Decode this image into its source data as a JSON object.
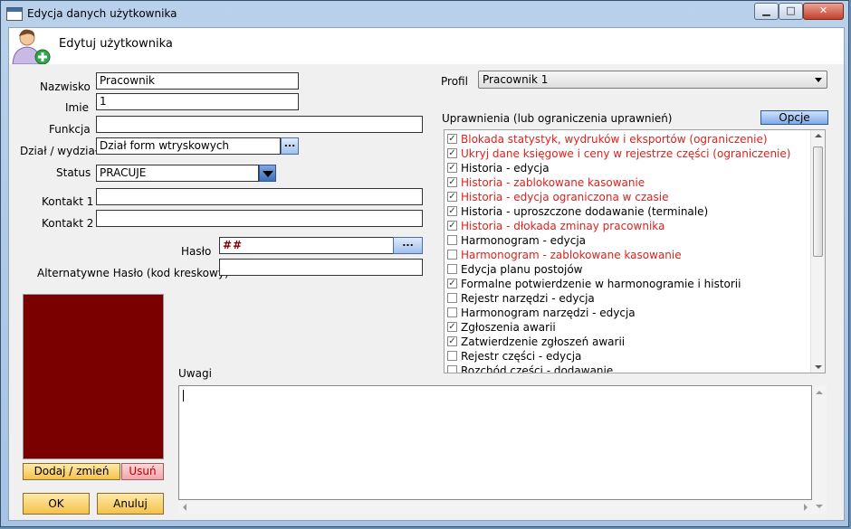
{
  "window": {
    "title": "Edycja danych użytkownika",
    "minimize": "▁",
    "maximize": "□",
    "close": "✕"
  },
  "header": {
    "title": "Edytuj użytkownika"
  },
  "form": {
    "nazwisko_label": "Nazwisko",
    "nazwisko_value": "Pracownik",
    "imie_label": "Imie",
    "imie_value": "1",
    "funkcja_label": "Funkcja",
    "funkcja_value": "",
    "dzial_label": "Dział / wydział",
    "dzial_value": "Dział form wtryskowych",
    "dzial_button": "...",
    "status_label": "Status",
    "status_value": "PRACUJE",
    "kontakt1_label": "Kontakt 1",
    "kontakt1_value": "",
    "kontakt2_label": "Kontakt 2",
    "kontakt2_value": "",
    "haslo_label": "Hasło",
    "haslo_value": "##",
    "haslo_button": "...",
    "alt_haslo_label": "Alternatywne Hasło (kod kreskowy)",
    "alt_haslo_value": "",
    "uwagi_label": "Uwagi",
    "uwagi_value": ""
  },
  "profile": {
    "label": "Profil",
    "value": "Pracownik 1"
  },
  "permissions": {
    "label": "Uprawnienia (lub ograniczenia uprawnień)",
    "options_button": "Opcje",
    "items": [
      {
        "label": "Blokada statystyk, wydruków i eksportów (ograniczenie)",
        "checked": true,
        "restriction": true
      },
      {
        "label": "Ukryj dane księgowe i ceny w rejestrze części (ograniczenie)",
        "checked": true,
        "restriction": true
      },
      {
        "label": "Historia - edycja",
        "checked": true,
        "restriction": false
      },
      {
        "label": "Historia - zablokowane kasowanie",
        "checked": true,
        "restriction": true
      },
      {
        "label": "Historia - edycja ograniczona w czasie",
        "checked": true,
        "restriction": true
      },
      {
        "label": "Historia - uproszczone dodawanie (terminale)",
        "checked": true,
        "restriction": false
      },
      {
        "label": "Historia - dłokada zminay pracownika",
        "checked": true,
        "restriction": true
      },
      {
        "label": "Harmonogram - edycja",
        "checked": false,
        "restriction": false
      },
      {
        "label": "Harmonogram - zablokowane kasowanie",
        "checked": false,
        "restriction": true
      },
      {
        "label": "Edycja planu postojów",
        "checked": false,
        "restriction": false
      },
      {
        "label": "Formalne potwierdzenie w harmonogramie i historii",
        "checked": true,
        "restriction": false
      },
      {
        "label": "Rejestr narzędzi - edycja",
        "checked": false,
        "restriction": false
      },
      {
        "label": "Harmonogram narzędzi - edycja",
        "checked": false,
        "restriction": false
      },
      {
        "label": "Zgłoszenia awarii",
        "checked": true,
        "restriction": false
      },
      {
        "label": "Zatwierdzenie zgłoszeń awarii",
        "checked": true,
        "restriction": false
      },
      {
        "label": "Rejestr części - edycja",
        "checked": false,
        "restriction": false
      },
      {
        "label": "Rozchód części - dodawanie",
        "checked": false,
        "restriction": false
      }
    ]
  },
  "photo": {
    "add_button": "Dodaj / zmień",
    "remove_button": "Usuń"
  },
  "buttons": {
    "ok": "OK",
    "cancel": "Anuluj"
  },
  "colors": {
    "restriction_text": "#e0201c",
    "photo_bg": "#7a0000"
  }
}
